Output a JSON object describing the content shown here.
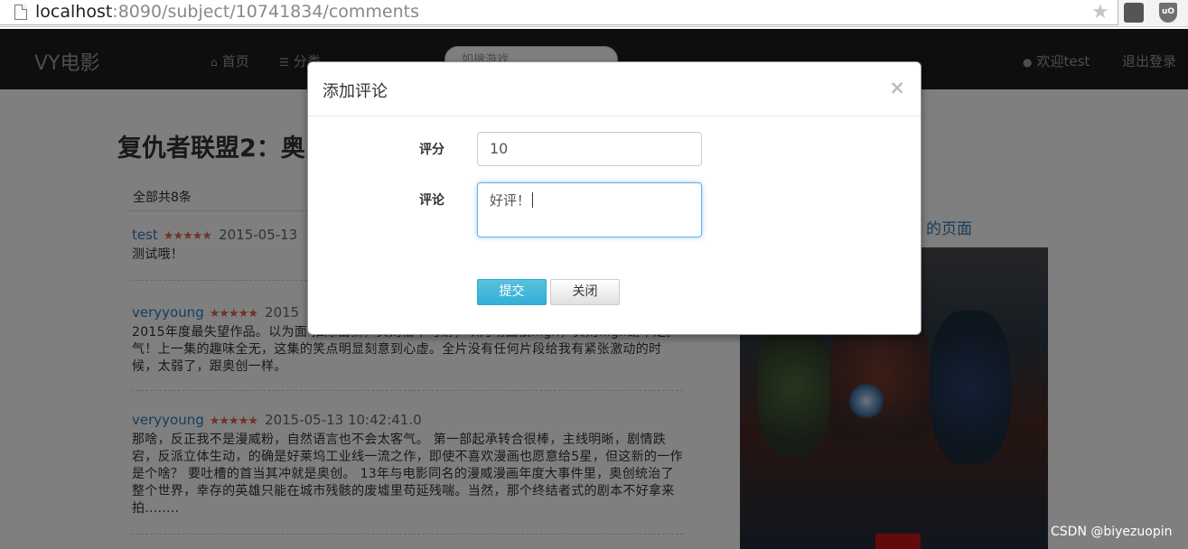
{
  "browser": {
    "url_host": "localhost",
    "url_rest": ":8090/subject/10741834/comments"
  },
  "navbar": {
    "brand": "VY电影",
    "home_label": "首页",
    "category_label": "分类",
    "search_placeholder": "如搜游戏",
    "user_label": "欢迎test",
    "logout_label": "退出登录"
  },
  "page": {
    "movie_title": "复仇者联盟2：奥",
    "total_label": "全部共8条",
    "side_link": "的页面",
    "comments": [
      {
        "user": "test",
        "stars": "★★★★★",
        "date": "2015-05-13",
        "text": "测试哦！"
      },
      {
        "user": "veryyoung",
        "stars": "★★★★★",
        "date": "2015",
        "text": "2015年度最失望作品。以为面                                                                    推陈出新，实则俗不可耐；以为场面很high，实则high劲不足。气！上一集的趣味全无，这集的笑点明显刻意到心虚。全片没有任何片段给我有紧张激动的时候，太弱了，跟奥创一样。"
      },
      {
        "user": "veryyoung",
        "stars": "★★★★★",
        "date": "2015-05-13 10:42:41.0",
        "text": "那啥，反正我不是漫威粉，自然语言也不会太客气。 第一部起承转合很棒，主线明晰，剧情跌宕，反派立体生动，的确是好莱坞工业线一流之作，即使不喜欢漫画也愿意给5星，但这新的一作是个啥？ 要吐槽的首当其冲就是奥创。 13年与电影同名的漫威漫画年度大事件里，奥创统治了整个世界，幸存的英雄只能在城市残骸的废墟里苟延残喘。当然，那个终结者式的剧本不好拿来拍........"
      }
    ]
  },
  "modal": {
    "title": "添加评论",
    "close_symbol": "×",
    "score_label": "评分",
    "score_value": "10",
    "comment_label": "评论",
    "comment_value": "好评！",
    "submit_label": "提交",
    "close_label": "关闭"
  },
  "watermark": "CSDN @biyezuopin"
}
